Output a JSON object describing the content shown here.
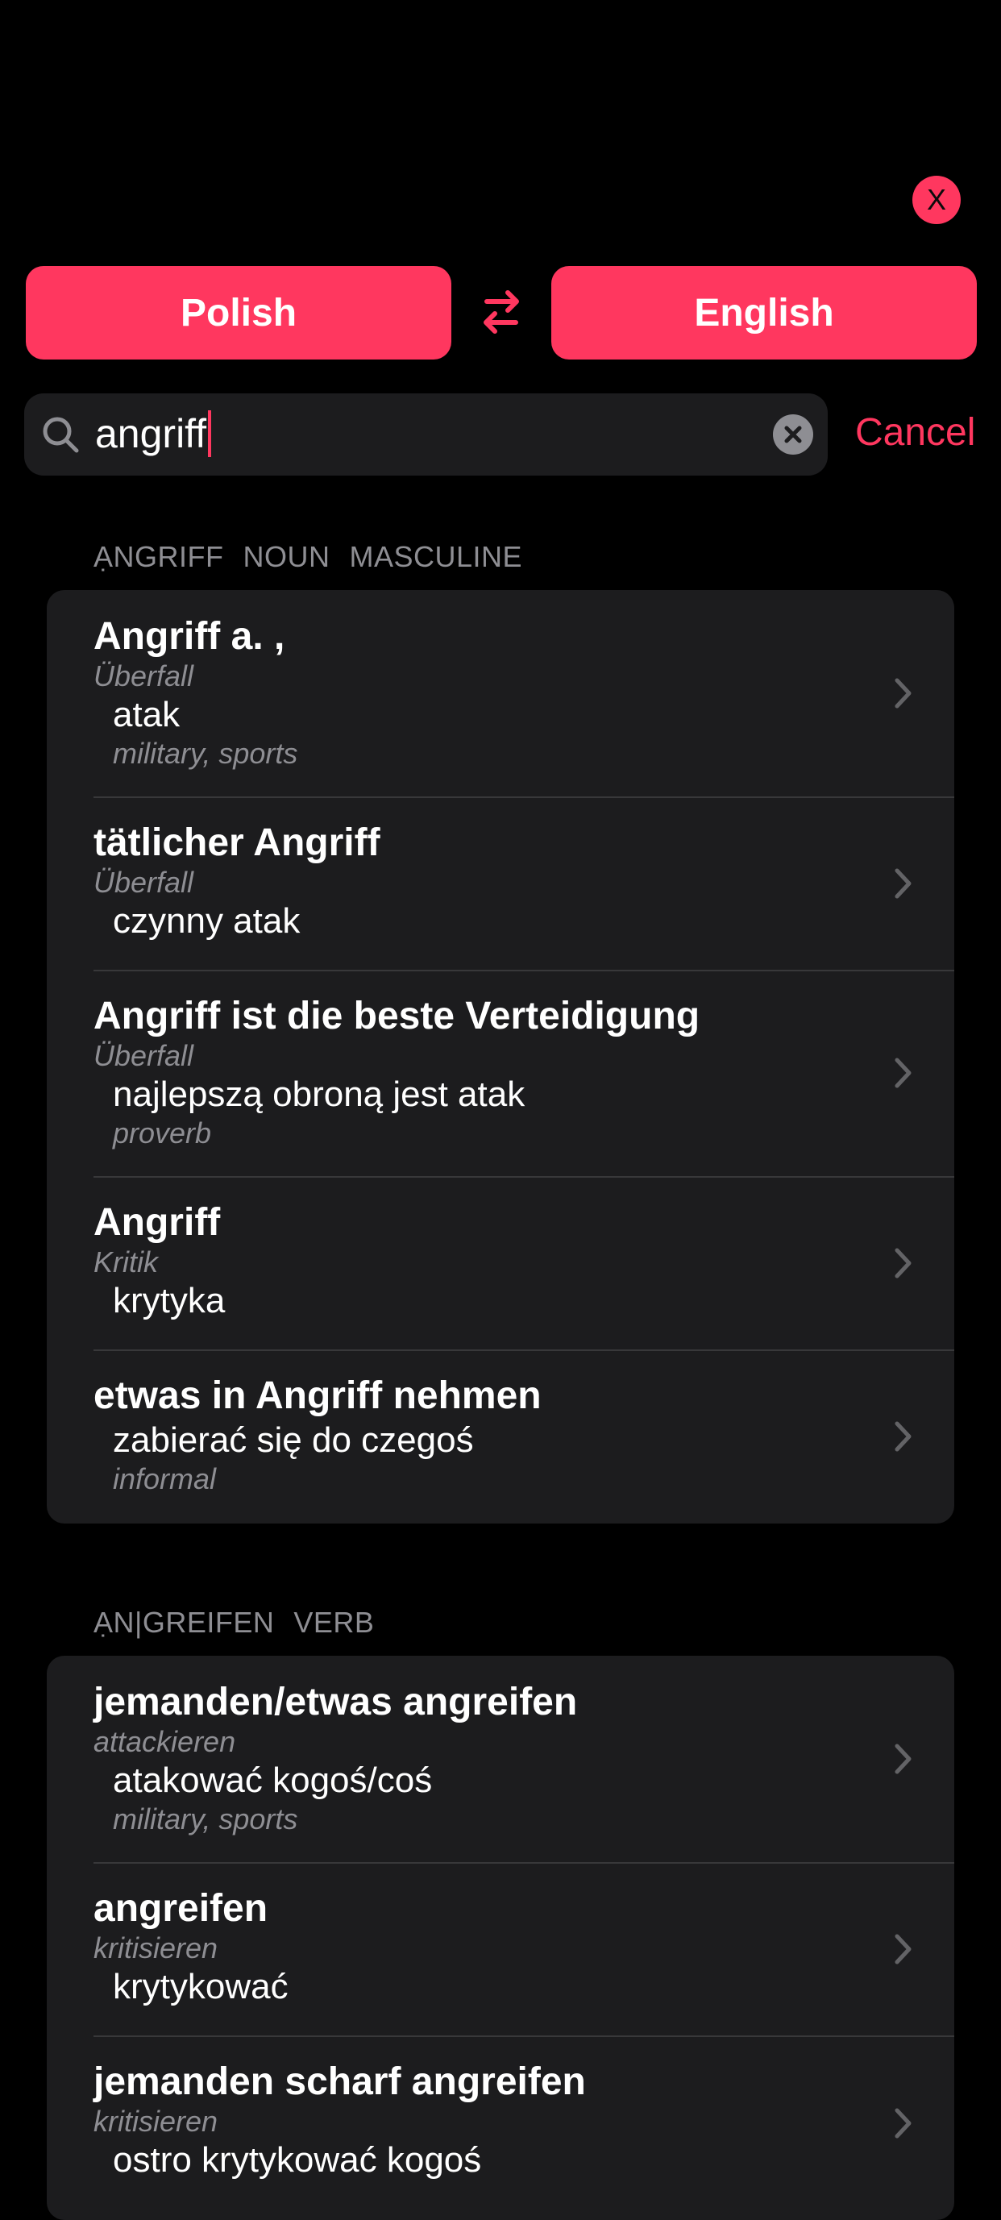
{
  "close_label": "X",
  "languages": {
    "from": "Polish",
    "to": "English"
  },
  "search": {
    "value": "angriff",
    "cancel_label": "Cancel"
  },
  "sections": [
    {
      "header": [
        "ẠNGRIFF",
        "NOUN",
        "MASCULINE"
      ],
      "entries": [
        {
          "headword": "Angriff a. ,",
          "sense": "Überfall",
          "translation": "atak",
          "note": "military, sports"
        },
        {
          "headword": "tätlicher Angriff",
          "sense": "Überfall",
          "translation": "czynny atak",
          "note": ""
        },
        {
          "headword": "Angriff ist die beste Verteidigung",
          "sense": "Überfall",
          "translation": "najlepszą obroną jest atak",
          "note": "proverb"
        },
        {
          "headword": "Angriff",
          "sense": "Kritik",
          "translation": "krytyka",
          "note": ""
        },
        {
          "headword": "etwas in Angriff nehmen",
          "sense": "",
          "translation": "zabierać się do czegoś",
          "note": "informal"
        }
      ]
    },
    {
      "header": [
        "ẠN|GREIFEN",
        "VERB"
      ],
      "entries": [
        {
          "headword": "jemanden/etwas angreifen",
          "sense": "attackieren",
          "translation": "atakować kogoś/coś",
          "note": "military, sports"
        },
        {
          "headword": "angreifen",
          "sense": "kritisieren",
          "translation": "krytykować",
          "note": ""
        },
        {
          "headword": "jemanden scharf angreifen",
          "sense": "kritisieren",
          "translation": "ostro krytykować kogoś",
          "note": ""
        }
      ]
    }
  ],
  "colors": {
    "accent": "#ff375f",
    "background": "#000000",
    "card": "#1c1c1e",
    "secondary_text": "#8e8e93"
  },
  "icons": {
    "close": "close-icon",
    "swap": "swap-arrows-icon",
    "search": "search-icon",
    "clear": "clear-icon",
    "chevron": "chevron-right-icon"
  }
}
